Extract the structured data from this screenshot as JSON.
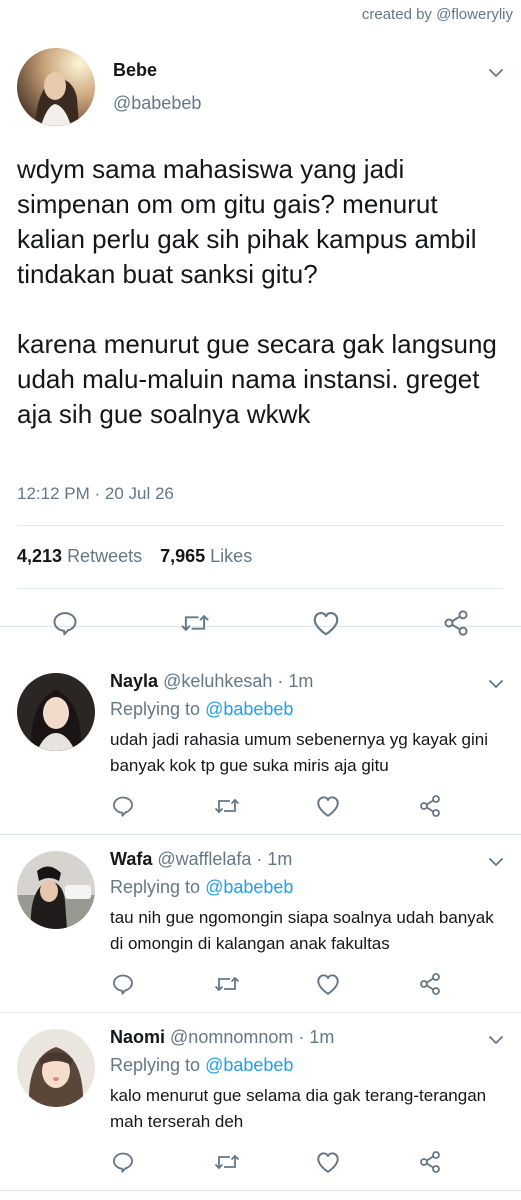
{
  "credit": "created by @floweryliy",
  "main_tweet": {
    "name": "Bebe",
    "handle": "@babebeb",
    "text": "wdym sama mahasiswa yang jadi simpenan om om gitu gais? menurut kalian perlu gak sih pihak kampus ambil tindakan buat sanksi gitu?\n\nkarena menurut gue secara gak langsung udah malu-maluin nama instansi. greget aja sih gue soalnya wkwk",
    "timestamp": "12:12 PM · 20 Jul 26",
    "retweets_count": "4,213",
    "retweets_label": "Retweets",
    "likes_count": "7,965",
    "likes_label": "Likes"
  },
  "replies": [
    {
      "name": "Nayla",
      "handle": "@keluhkesah",
      "time": "· 1m",
      "replying_label": "Replying to",
      "replying_to": "@babebeb",
      "text": "udah jadi rahasia umum sebenernya yg kayak gini banyak kok tp gue suka miris aja gitu"
    },
    {
      "name": "Wafa",
      "handle": "@wafflelafa",
      "time": "· 1m",
      "replying_label": "Replying to",
      "replying_to": "@babebeb",
      "text": "tau nih gue ngomongin siapa soalnya udah banyak di omongin di kalangan anak fakultas"
    },
    {
      "name": "Naomi",
      "handle": "@nomnomnom",
      "time": "· 1m",
      "replying_label": "Replying to",
      "replying_to": "@babebeb",
      "text": "kalo menurut gue selama dia gak terang-terangan mah terserah deh"
    }
  ],
  "colors": {
    "accent": "#1da1f2",
    "secondary_text": "#657786",
    "icon": "#657786",
    "divider": "#e1e8ed"
  },
  "icons": [
    "chevron-down-icon",
    "reply-icon",
    "retweet-icon",
    "like-icon",
    "share-icon"
  ]
}
